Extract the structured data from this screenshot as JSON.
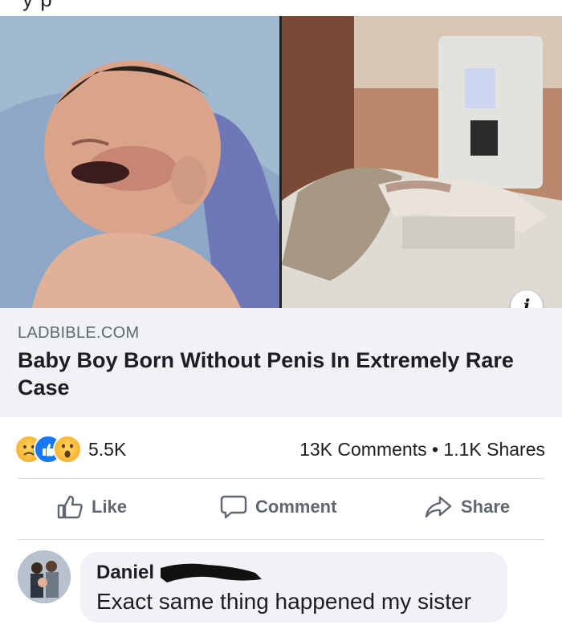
{
  "top_partial_text": "y p",
  "link_preview": {
    "domain": "LADBIBLE.COM",
    "title": "Baby Boy Born Without Penis In Extremely Rare Case",
    "info_label": "i"
  },
  "stats": {
    "reactions": [
      "sad",
      "like",
      "wow"
    ],
    "reaction_count": "5.5K",
    "comments_shares": "13K Comments • 1.1K Shares"
  },
  "actions": {
    "like": "Like",
    "comment": "Comment",
    "share": "Share"
  },
  "comment": {
    "author": "Daniel",
    "text": "Exact same thing happened my sister"
  },
  "colors": {
    "brand": "#1877f2",
    "text_primary": "#1c1e21",
    "text_secondary": "#606770",
    "bubble_bg": "#f0f2f5"
  },
  "icons": [
    "info-icon",
    "like-thumb-icon",
    "comment-bubble-icon",
    "share-arrow-icon",
    "sad-reaction-icon",
    "like-reaction-icon",
    "wow-reaction-icon"
  ]
}
